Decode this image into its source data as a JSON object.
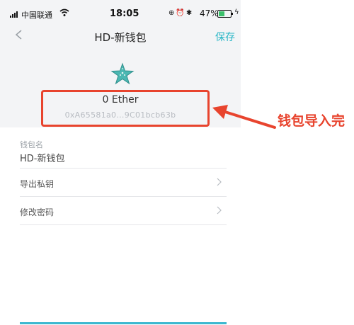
{
  "status_bar": {
    "carrier": "中国联通",
    "time": "18:05",
    "battery_percent": "47%"
  },
  "nav": {
    "title": "HD-新钱包",
    "save_label": "保存"
  },
  "wallet": {
    "balance": "0 Ether",
    "address": "0xA65581a0...9C01bcb63b"
  },
  "form": {
    "name_label": "钱包名",
    "name_value": "HD-新钱包"
  },
  "menu": [
    {
      "label": "导出私钥"
    },
    {
      "label": "修改密码"
    }
  ],
  "annotation": {
    "text": "钱包导入完"
  },
  "colors": {
    "accent": "#28b6c6",
    "annotation_red": "#e8442e"
  }
}
